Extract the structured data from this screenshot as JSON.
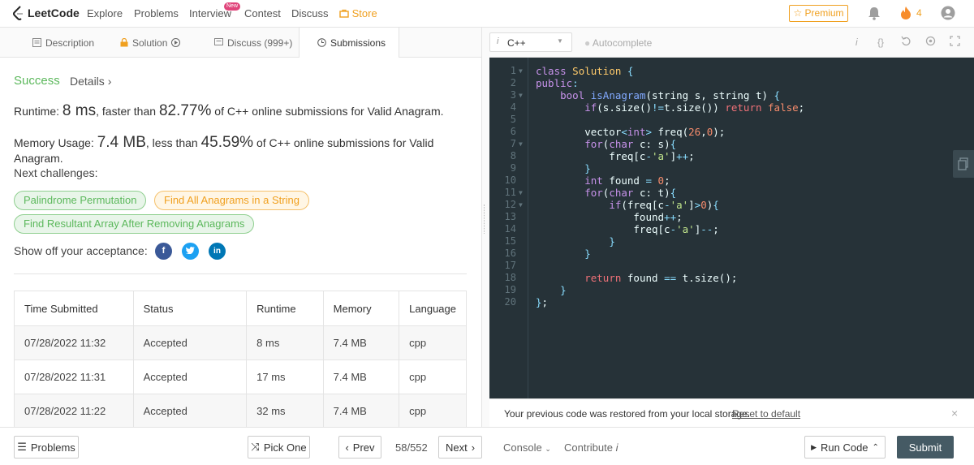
{
  "nav": {
    "logo": "LeetCode",
    "items": [
      "Explore",
      "Problems",
      "Interview",
      "Contest",
      "Discuss",
      "Store"
    ],
    "new_badge": "New",
    "premium": "Premium",
    "fire_count": "4"
  },
  "tabs": {
    "description": "Description",
    "solution": "Solution",
    "discuss": "Discuss (999+)",
    "submissions": "Submissions"
  },
  "result": {
    "status": "Success",
    "details": "Details",
    "runtime_label": "Runtime: ",
    "runtime_value": "8 ms",
    "runtime_mid": ", faster than ",
    "runtime_pct": "82.77%",
    "runtime_tail": " of C++ online submissions for Valid Anagram.",
    "memory_label": "Memory Usage: ",
    "memory_value": "7.4 MB",
    "memory_mid": ", less than ",
    "memory_pct": "45.59%",
    "memory_tail": " of C++ online submissions for Valid Anagram.",
    "next_label": "Next challenges:",
    "challenges": [
      "Palindrome Permutation",
      "Find All Anagrams in a String",
      "Find Resultant Array After Removing Anagrams"
    ],
    "showoff": "Show off your acceptance:"
  },
  "table": {
    "headers": [
      "Time Submitted",
      "Status",
      "Runtime",
      "Memory",
      "Language"
    ],
    "rows": [
      [
        "07/28/2022 11:32",
        "Accepted",
        "8 ms",
        "7.4 MB",
        "cpp"
      ],
      [
        "07/28/2022 11:31",
        "Accepted",
        "17 ms",
        "7.4 MB",
        "cpp"
      ],
      [
        "07/28/2022 11:22",
        "Accepted",
        "32 ms",
        "7.4 MB",
        "cpp"
      ]
    ]
  },
  "editor": {
    "language": "C++",
    "autocomplete": "Autocomplete",
    "line_numbers": [
      "1",
      "2",
      "3",
      "4",
      "5",
      "6",
      "7",
      "8",
      "9",
      "10",
      "11",
      "12",
      "13",
      "14",
      "15",
      "16",
      "17",
      "18",
      "19",
      "20"
    ]
  },
  "restore": {
    "message": "Your previous code was restored from your local storage.",
    "reset": "Reset to default"
  },
  "bottom": {
    "problems": "Problems",
    "pick_one": "Pick One",
    "prev": "Prev",
    "pager": "58/552",
    "next": "Next",
    "console": "Console",
    "contribute": "Contribute",
    "run_code": "Run Code",
    "submit": "Submit"
  },
  "colors": {
    "success": "#5cb85c",
    "accent": "#f0a020",
    "editor_bg": "#263238",
    "submit_bg": "#455a64"
  }
}
